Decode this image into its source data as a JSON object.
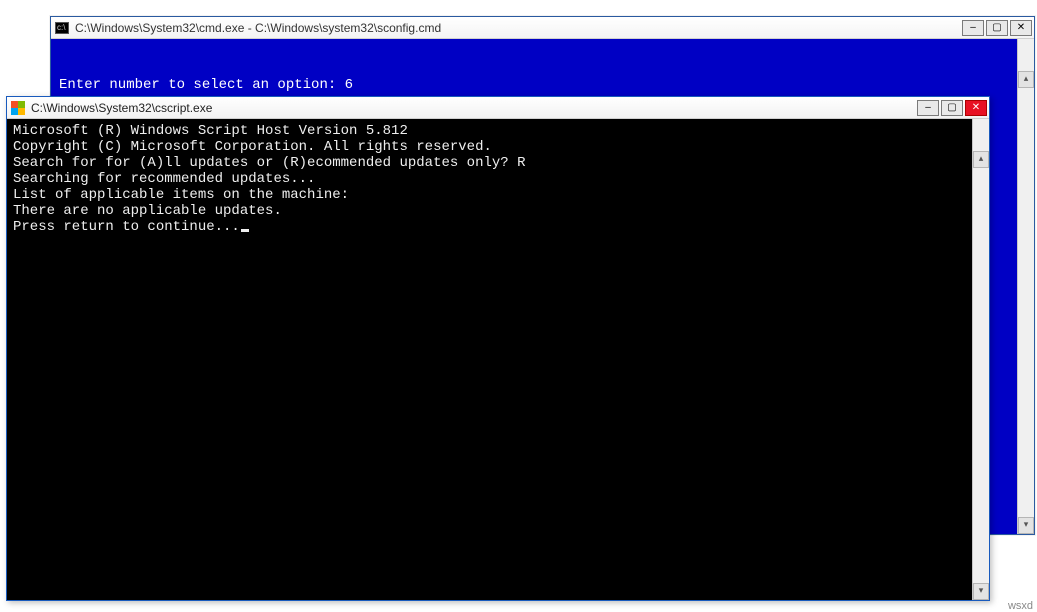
{
  "watermark": "wsxd",
  "back_window": {
    "title": "C:\\Windows\\System32\\cmd.exe - C:\\Windows\\system32\\sconfig.cmd",
    "lines": {
      "l1": "",
      "l2": "Enter number to select an option: 6"
    }
  },
  "front_window": {
    "title": "C:\\Windows\\System32\\cscript.exe",
    "lines": {
      "l1": "Microsoft (R) Windows Script Host Version 5.812",
      "l2": "Copyright (C) Microsoft Corporation. All rights reserved.",
      "l3": "",
      "l4": "Search for for (A)ll updates or (R)ecommended updates only? R",
      "l5": "",
      "l6": "Searching for recommended updates...",
      "l7": "",
      "l8": "List of applicable items on the machine:",
      "l9": "",
      "l10": "",
      "l11": "There are no applicable updates.",
      "l12": "",
      "l13": "Press return to continue..."
    }
  },
  "buttons": {
    "min_glyph": "–",
    "max_glyph": "▢",
    "close_glyph": "✕"
  },
  "scroll": {
    "up": "▴",
    "down": "▾"
  }
}
